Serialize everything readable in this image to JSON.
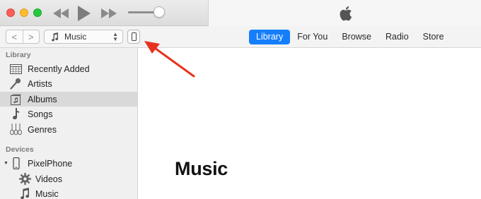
{
  "window": {
    "controls": [
      "close",
      "minimize",
      "zoom"
    ]
  },
  "player": {
    "rewind_icon": "rewind-icon",
    "play_icon": "play-icon",
    "fast_forward_icon": "fast-forward-icon",
    "volume_level": 0.85,
    "lcd_icon": "apple-logo-icon"
  },
  "toolbar": {
    "back": "<",
    "forward": ">",
    "media_type": "Music",
    "media_type_icon": "music-note-icon",
    "device_icon": "iphone-icon",
    "tabs": [
      {
        "label": "Library",
        "active": true
      },
      {
        "label": "For You",
        "active": false
      },
      {
        "label": "Browse",
        "active": false
      },
      {
        "label": "Radio",
        "active": false
      },
      {
        "label": "Store",
        "active": false
      }
    ]
  },
  "sidebar": {
    "library_heading": "Library",
    "library_items": [
      {
        "label": "Recently Added",
        "icon": "calendar-grid-icon",
        "selected": false
      },
      {
        "label": "Artists",
        "icon": "microphone-icon",
        "selected": false
      },
      {
        "label": "Albums",
        "icon": "album-icon",
        "selected": true
      },
      {
        "label": "Songs",
        "icon": "music-note-icon",
        "selected": false
      },
      {
        "label": "Genres",
        "icon": "guitar-icon",
        "selected": false
      }
    ],
    "devices_heading": "Devices",
    "device": {
      "label": "PixelPhone",
      "icon": "iphone-icon",
      "expanded": true
    },
    "device_items": [
      {
        "label": "Videos",
        "icon": "gear-icon"
      },
      {
        "label": "Music",
        "icon": "music-note-icon"
      }
    ]
  },
  "main": {
    "title": "Music"
  },
  "annotation": {
    "arrow_color": "#e8321f"
  },
  "colors": {
    "accent": "#157efb"
  }
}
